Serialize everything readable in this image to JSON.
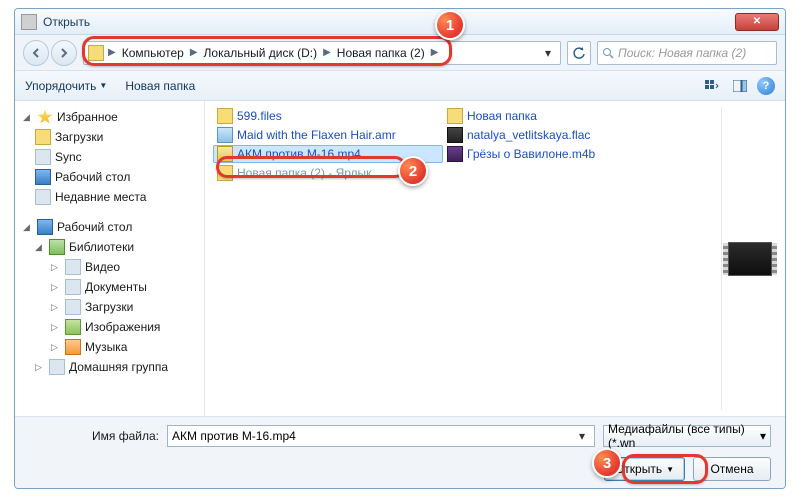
{
  "window": {
    "title": "Открыть"
  },
  "breadcrumb": {
    "items": [
      "Компьютер",
      "Локальный диск (D:)",
      "Новая папка (2)"
    ]
  },
  "search": {
    "placeholder": "Поиск: Новая папка (2)"
  },
  "toolbar": {
    "organize": "Упорядочить",
    "new_folder": "Новая папка"
  },
  "nav": {
    "favorites": {
      "label": "Избранное",
      "items": [
        "Загрузки",
        "Sync",
        "Рабочий стол",
        "Недавние места"
      ]
    },
    "desktop": {
      "label": "Рабочий стол",
      "libraries": {
        "label": "Библиотеки",
        "items": [
          "Видео",
          "Документы",
          "Загрузки",
          "Изображения",
          "Музыка"
        ]
      },
      "homegroup": "Домашняя группа"
    }
  },
  "files": {
    "col1": [
      {
        "name": "599.files",
        "kind": "folder"
      },
      {
        "name": "Maid with the Flaxen Hair.amr",
        "kind": "media"
      },
      {
        "name": "АКМ против М-16.mp4",
        "kind": "video",
        "selected": true
      },
      {
        "name": "Новая папка (2) - Ярлык",
        "kind": "shortcut",
        "dim": true
      }
    ],
    "col2": [
      {
        "name": "Новая папка",
        "kind": "folder"
      },
      {
        "name": "natalya_vetlitskaya.flac",
        "kind": "flac"
      },
      {
        "name": "Грёзы о Вавилоне.m4b",
        "kind": "m4b"
      }
    ]
  },
  "bottom": {
    "filename_label": "Имя файла:",
    "filename_value": "АКМ против М-16.mp4",
    "filter_label": "Медиафайлы (все типы) (*.wn",
    "open": "Открыть",
    "cancel": "Отмена"
  },
  "callouts": {
    "c1": "1",
    "c2": "2",
    "c3": "3"
  }
}
